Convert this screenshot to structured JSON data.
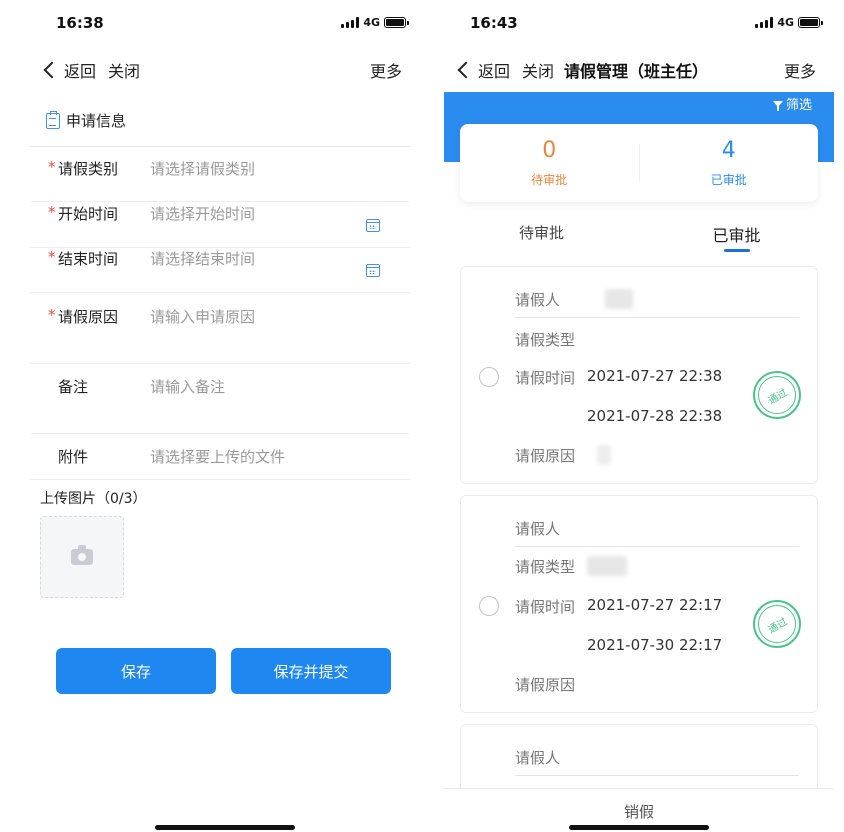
{
  "left": {
    "status": {
      "time": "16:38",
      "network": "4G"
    },
    "nav": {
      "back": "返回",
      "close": "关闭",
      "more": "更多"
    },
    "section_title": "申请信息",
    "fields": [
      {
        "label": "请假类别",
        "placeholder": "请选择请假类别",
        "required": true,
        "icon": ""
      },
      {
        "label": "开始时间",
        "placeholder": "请选择开始时间",
        "required": true,
        "icon": "calendar-icon"
      },
      {
        "label": "结束时间",
        "placeholder": "请选择结束时间",
        "required": true,
        "icon": "calendar-icon"
      },
      {
        "label": "请假原因",
        "placeholder": "请输入申请原因",
        "required": true,
        "icon": ""
      },
      {
        "label": "备注",
        "placeholder": "请输入备注",
        "required": false,
        "icon": ""
      },
      {
        "label": "附件",
        "placeholder": "请选择要上传的文件",
        "required": false,
        "icon": ""
      }
    ],
    "upload_label": "上传图片（0/3）",
    "save_label": "保存",
    "submit_label": "保存并提交",
    "accent_color": "#1e88f0"
  },
  "right": {
    "status": {
      "time": "16:43",
      "network": "4G"
    },
    "nav": {
      "back": "返回",
      "close": "关闭",
      "title": "请假管理（班主任）",
      "more": "更多"
    },
    "filter_label": "筛选",
    "stats": [
      {
        "value": "0",
        "label": "待审批",
        "color": "#e8863f"
      },
      {
        "value": "4",
        "label": "已审批",
        "color": "#2b8cef"
      }
    ],
    "tabs": [
      {
        "label": "待审批",
        "active": false
      },
      {
        "label": "已审批",
        "active": true
      }
    ],
    "field_labels": {
      "applicant": "请假人",
      "type": "请假类型",
      "time": "请假时间",
      "reason": "请假原因"
    },
    "records": [
      {
        "start": "2021-07-27 22:38",
        "end": "2021-07-28 22:38",
        "stamp": "通过"
      },
      {
        "start": "2021-07-27 22:17",
        "end": "2021-07-30 22:17",
        "stamp": "通过"
      },
      {
        "start": "",
        "end": "",
        "stamp": ""
      }
    ],
    "bottom_action": "销假",
    "band_color": "#2b8cef",
    "stamp_color": "#4cc38a"
  }
}
